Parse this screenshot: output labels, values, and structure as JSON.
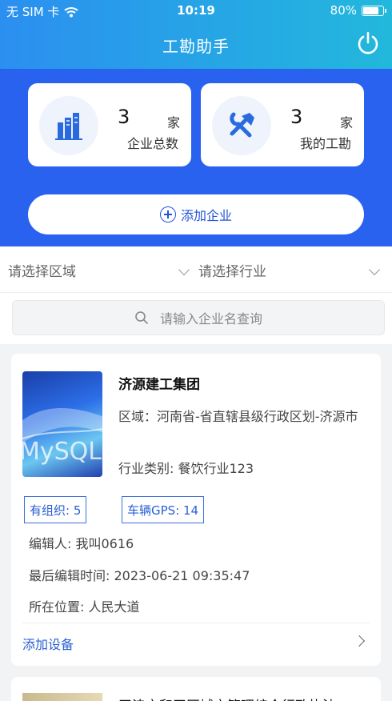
{
  "status_bar": {
    "carrier": "无 SIM 卡",
    "time": "10:19",
    "battery": "80%"
  },
  "header": {
    "title": "工勘助手"
  },
  "stats": [
    {
      "count": "3",
      "unit": "家",
      "label": "企业总数",
      "icon": "building-chart-icon"
    },
    {
      "count": "3",
      "unit": "家",
      "label": "我的工勘",
      "icon": "tools-icon"
    }
  ],
  "add_company": {
    "label": "添加企业"
  },
  "filters": {
    "region_placeholder": "请选择区域",
    "industry_placeholder": "请选择行业"
  },
  "search": {
    "placeholder": "请输入企业名查询"
  },
  "company": {
    "thumbnail_text": "MySQL",
    "name": "济源建工集团",
    "region": "区域：河南省-省直辖县级行政区划-济源市",
    "industry": "行业类别: 餐饮行业123",
    "tag_org": "有组织: 5",
    "tag_gps": "车辆GPS: 14",
    "editor": "编辑人: 我叫0616",
    "last_edit": "最后编辑时间: 2023-06-21 09:35:47",
    "location": "所在位置: 人民大道",
    "add_device": "添加设备"
  },
  "company2": {
    "name": "天津市和平区城市管理综合行政执法"
  },
  "colors": {
    "header_start": "#2b8ff0",
    "header_end": "#22b8dc",
    "primary": "#2a62f0",
    "link": "#2a5fd3"
  }
}
